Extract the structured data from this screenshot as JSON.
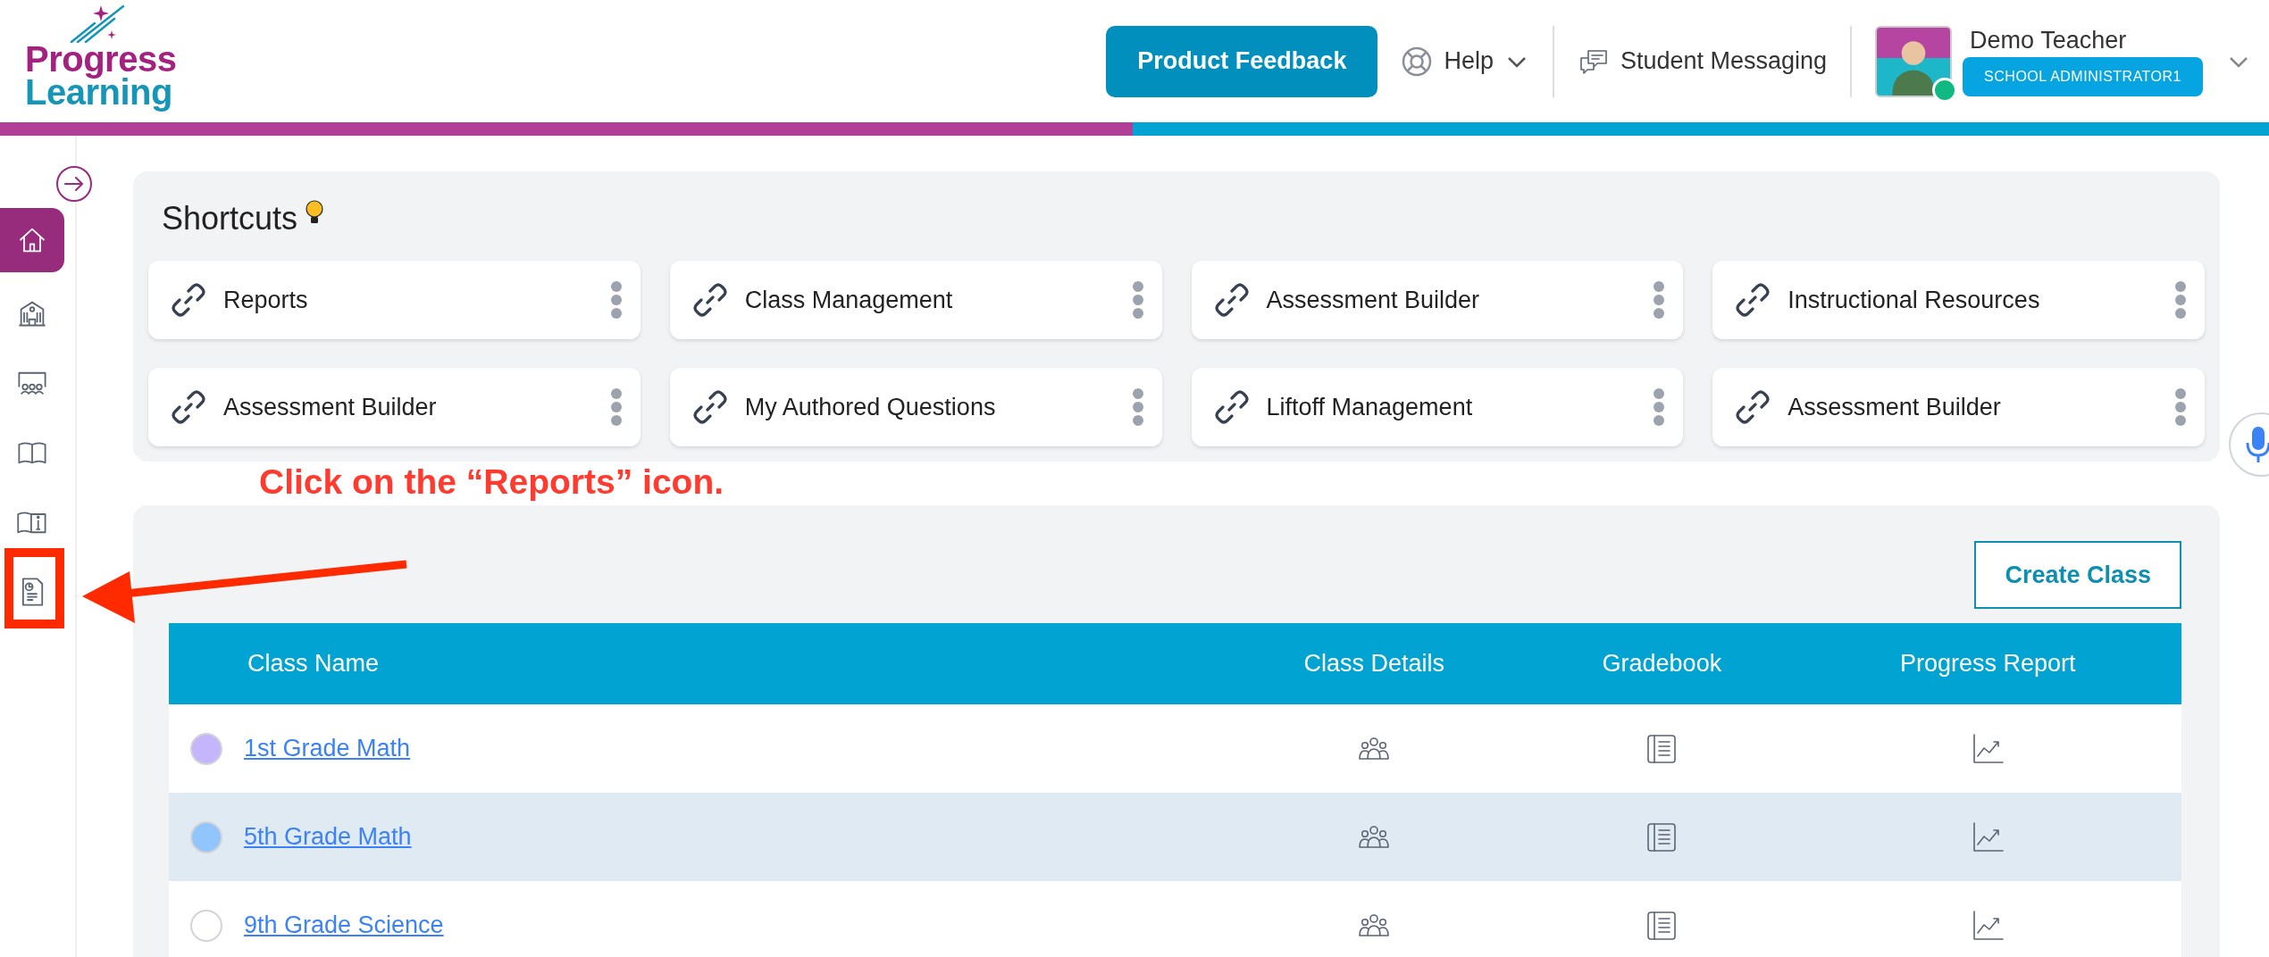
{
  "logo": {
    "line_1": "Progress",
    "line_2": "Learning"
  },
  "header": {
    "feedback_button": "Product Feedback",
    "help": "Help",
    "messaging": "Student Messaging"
  },
  "user": {
    "name": "Demo Teacher",
    "role": "SCHOOL ADMINISTRATOR1",
    "online": true
  },
  "sidebar": {
    "items": [
      {
        "kind": "home",
        "selected": true
      },
      {
        "kind": "school",
        "selected": false
      },
      {
        "kind": "classroom",
        "selected": false
      },
      {
        "kind": "book",
        "selected": false
      },
      {
        "kind": "book-info",
        "selected": false
      },
      {
        "kind": "report",
        "selected": false
      }
    ]
  },
  "shortcuts": {
    "title": "Shortcuts",
    "items": [
      {
        "label": "Reports"
      },
      {
        "label": "Class Management"
      },
      {
        "label": "Assessment Builder"
      },
      {
        "label": "Instructional Resources"
      },
      {
        "label": "Assessment Builder"
      },
      {
        "label": "My Authored Questions"
      },
      {
        "label": "Liftoff Management"
      },
      {
        "label": "Assessment Builder"
      }
    ]
  },
  "annotation": {
    "text": "Click on the “Reports” icon."
  },
  "classes": {
    "create_button": "Create Class",
    "table": {
      "columns": [
        "Class Name",
        "Class Details",
        "Gradebook",
        "Progress Report"
      ],
      "rows": [
        {
          "name": "1st Grade Math",
          "color": "#c4b5fd",
          "highlighted": false
        },
        {
          "name": "5th Grade Math",
          "color": "#93c5fd",
          "highlighted": true
        },
        {
          "name": "9th Grade Science",
          "color": "#ffffff",
          "highlighted": false
        }
      ]
    }
  }
}
